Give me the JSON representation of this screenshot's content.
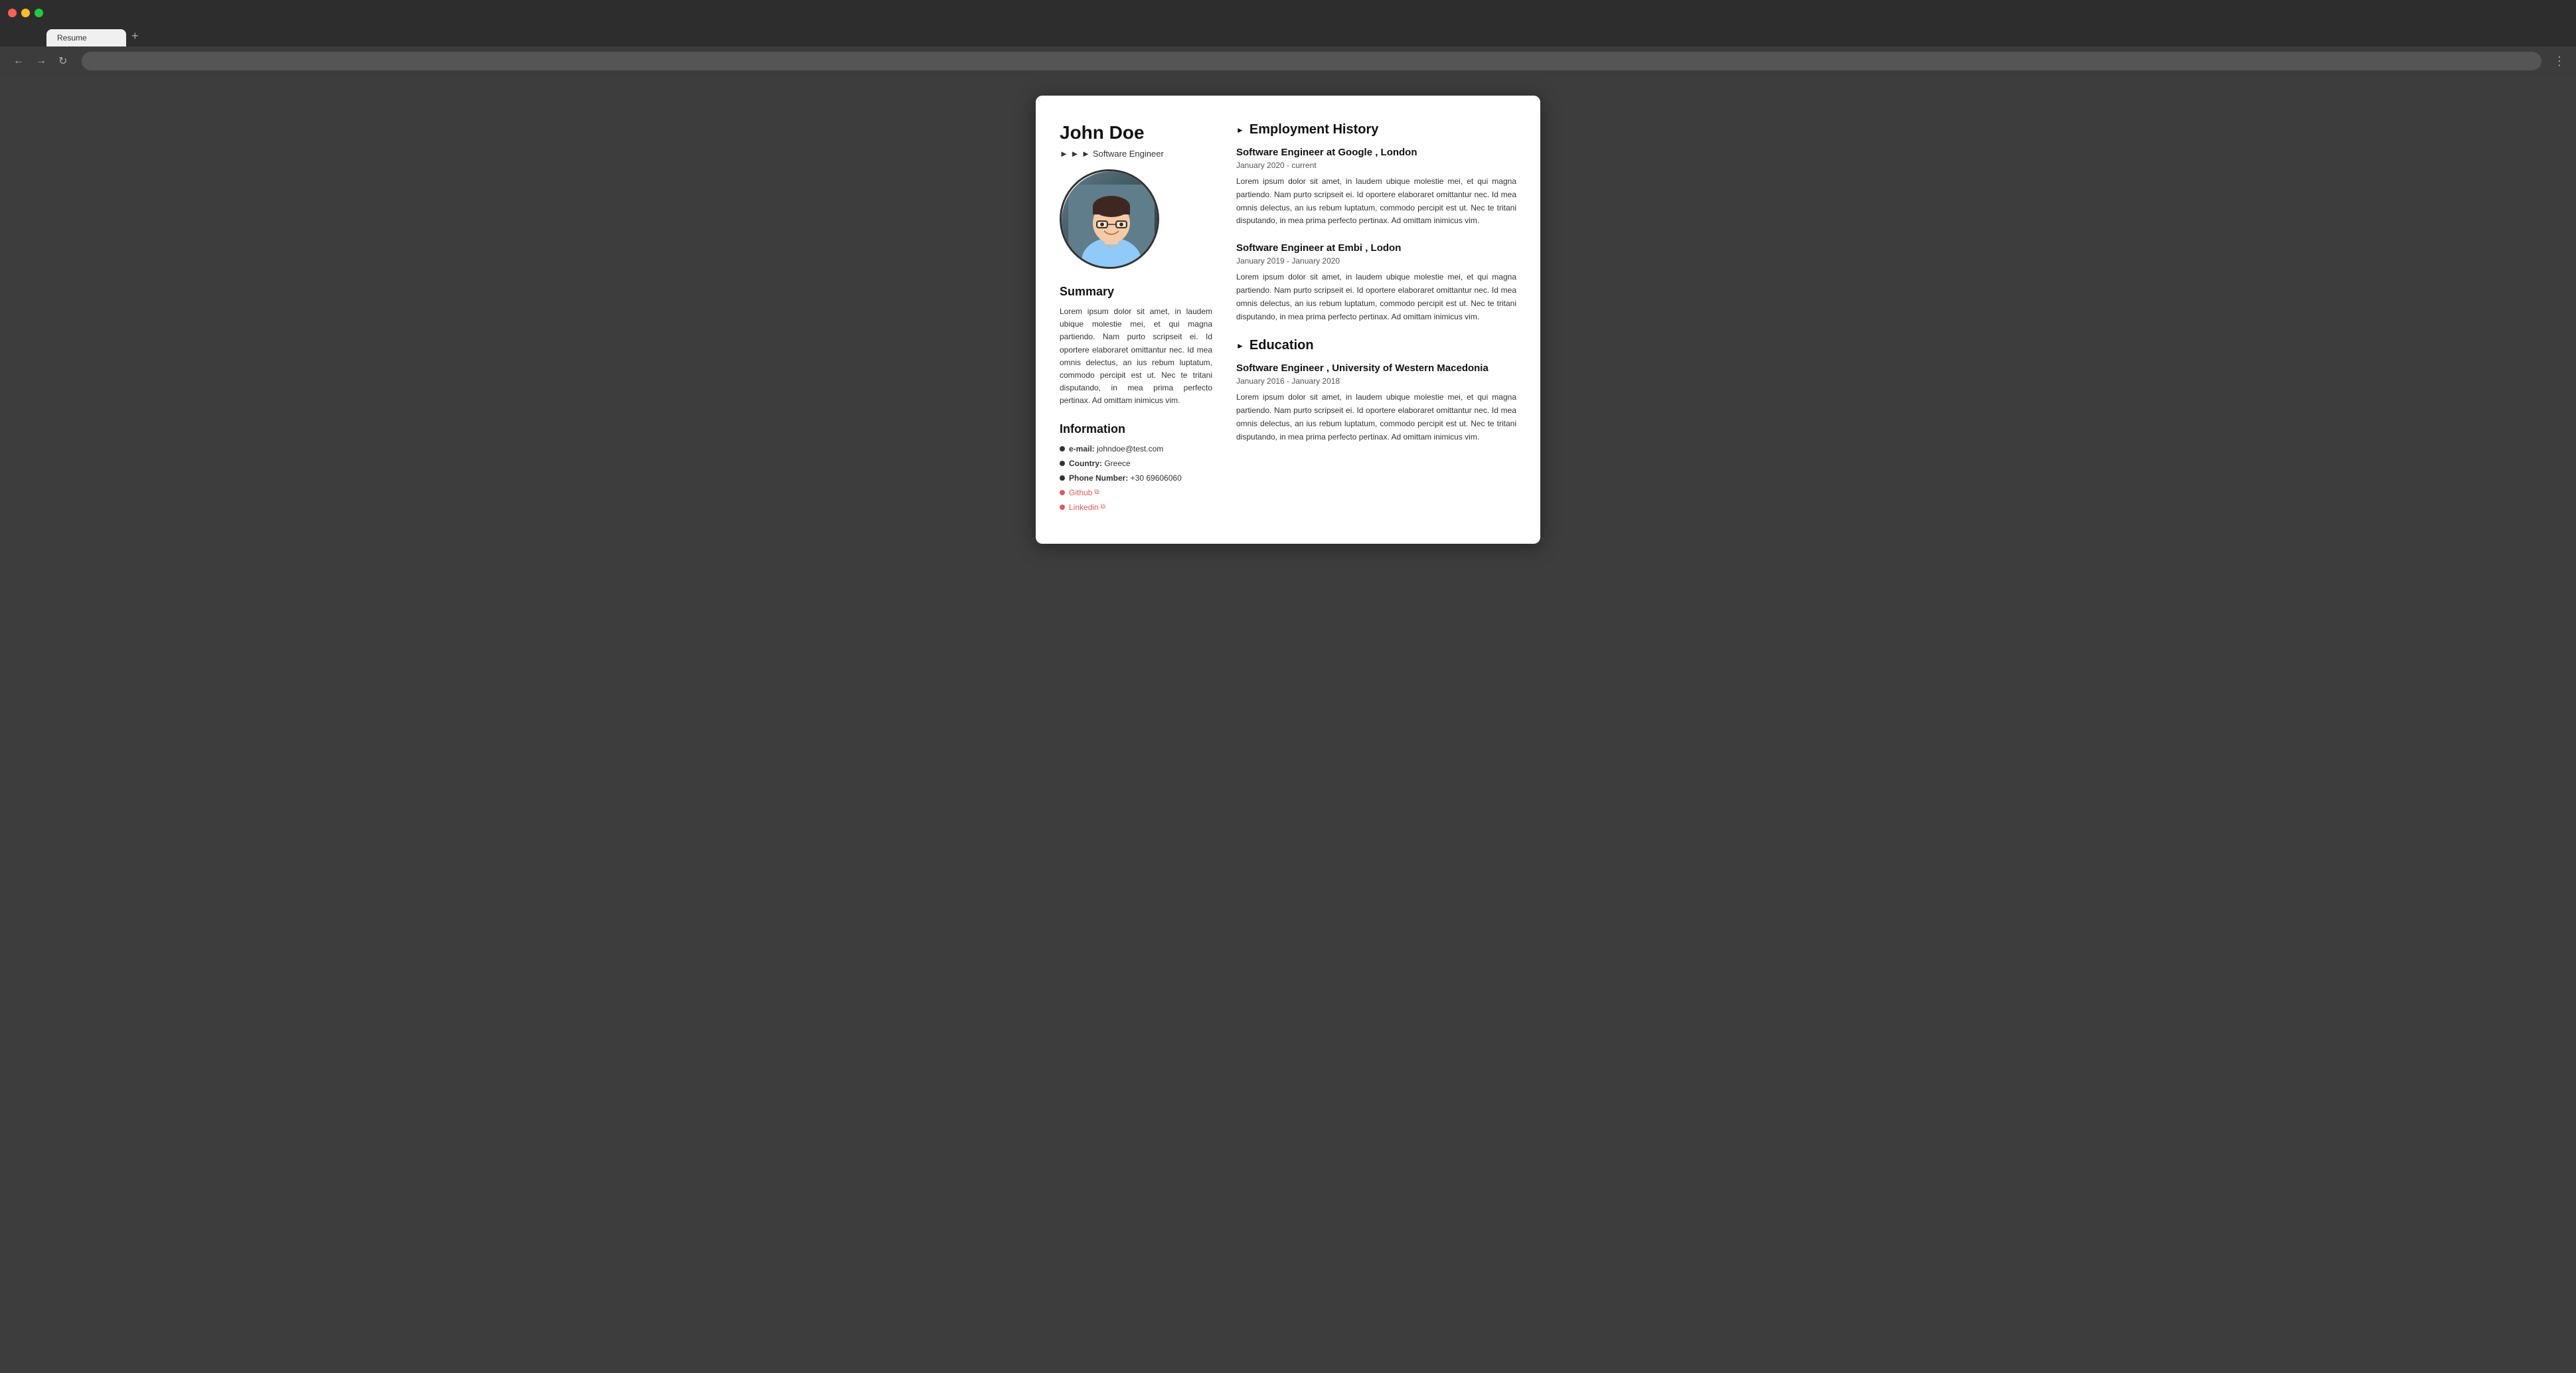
{
  "browser": {
    "traffic_lights": [
      "red",
      "yellow",
      "green"
    ],
    "tab_label": "Resume",
    "plus_label": "+",
    "nav": {
      "back": "←",
      "forward": "→",
      "refresh": "↻",
      "menu": "⋮"
    }
  },
  "profile": {
    "name": "John Doe",
    "title_arrows": "► ► ►",
    "title": "Software Engineer"
  },
  "summary": {
    "heading": "Summary",
    "text": "Lorem ipsum dolor sit amet, in laudem ubique molestie mei, et qui magna partiendo. Nam purto scripseit ei. Id oportere elaboraret omittantur nec. Id mea omnis delectus, an ius rebum luptatum, commodo percipit est ut. Nec te tritani disputando, in mea prima perfecto pertinax. Ad omittam inimicus vim."
  },
  "information": {
    "heading": "Information",
    "items": [
      {
        "label": "e-mail:",
        "value": "johndoe@test.com",
        "type": "text"
      },
      {
        "label": "Country:",
        "value": "Greece",
        "type": "text"
      },
      {
        "label": "Phone Number:",
        "value": "+30 69606060",
        "type": "text"
      },
      {
        "label": "Github",
        "value": "Github",
        "type": "link"
      },
      {
        "label": "Linkedin",
        "value": "Linkedin",
        "type": "link"
      }
    ]
  },
  "employment": {
    "heading": "Employment History",
    "jobs": [
      {
        "title": "Software Engineer at Google , London",
        "date": "January 2020 - current",
        "description": "Lorem ipsum dolor sit amet, in laudem ubique molestie mei, et qui magna partiendo. Nam purto scripseit ei. Id oportere elaboraret omittantur nec. Id mea omnis delectus, an ius rebum luptatum, commodo percipit est ut. Nec te tritani disputando, in mea prima perfecto pertinax. Ad omittam inimicus vim."
      },
      {
        "title": "Software Engineer at Embi , Lodon",
        "date": "January 2019 - January 2020",
        "description": "Lorem ipsum dolor sit amet, in laudem ubique molestie mei, et qui magna partiendo. Nam purto scripseit ei. Id oportere elaboraret omittantur nec. Id mea omnis delectus, an ius rebum luptatum, commodo percipit est ut. Nec te tritani disputando, in mea prima perfecto pertinax. Ad omittam inimicus vim."
      }
    ]
  },
  "education": {
    "heading": "Education",
    "items": [
      {
        "title": "Software Engineer , University of Western Macedonia",
        "date": "January 2016 - January 2018",
        "description": "Lorem ipsum dolor sit amet, in laudem ubique molestie mei, et qui magna partiendo. Nam purto scripseit ei. Id oportere elaboraret omittantur nec. Id mea omnis delectus, an ius rebum luptatum, commodo percipit est ut. Nec te tritani disputando, in mea prima perfecto pertinax. Ad omittam inimicus vim."
      }
    ]
  }
}
